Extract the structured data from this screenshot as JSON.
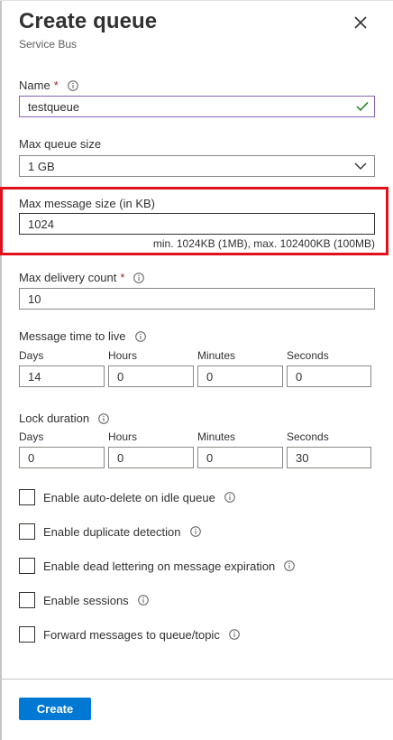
{
  "header": {
    "title": "Create queue",
    "subtitle": "Service Bus"
  },
  "form": {
    "name": {
      "label": "Name",
      "required": "*",
      "value": "testqueue"
    },
    "max_queue_size": {
      "label": "Max queue size",
      "value": "1 GB"
    },
    "max_message_size": {
      "label": "Max message size (in KB)",
      "value": "1024",
      "hint": "min. 1024KB (1MB), max. 102400KB (100MB)"
    },
    "max_delivery_count": {
      "label": "Max delivery count",
      "required": "*",
      "value": "10"
    },
    "message_ttl": {
      "label": "Message time to live",
      "days": {
        "label": "Days",
        "value": "14"
      },
      "hours": {
        "label": "Hours",
        "value": "0"
      },
      "minutes": {
        "label": "Minutes",
        "value": "0"
      },
      "seconds": {
        "label": "Seconds",
        "value": "0"
      }
    },
    "lock_duration": {
      "label": "Lock duration",
      "days": {
        "label": "Days",
        "value": "0"
      },
      "hours": {
        "label": "Hours",
        "value": "0"
      },
      "minutes": {
        "label": "Minutes",
        "value": "0"
      },
      "seconds": {
        "label": "Seconds",
        "value": "30"
      }
    },
    "checkboxes": [
      {
        "label": "Enable auto-delete on idle queue",
        "checked": false
      },
      {
        "label": "Enable duplicate detection",
        "checked": false
      },
      {
        "label": "Enable dead lettering on message expiration",
        "checked": false
      },
      {
        "label": "Enable sessions",
        "checked": false
      },
      {
        "label": "Forward messages to queue/topic",
        "checked": false
      }
    ]
  },
  "footer": {
    "create_label": "Create"
  },
  "colors": {
    "accent": "#0078d4",
    "highlight": "#e0111c",
    "valid": "#8764b8",
    "check": "#107c10"
  },
  "icons": {
    "close": "close-icon",
    "info": "info-icon",
    "check": "checkmark-icon",
    "chevron": "chevron-down-icon"
  }
}
